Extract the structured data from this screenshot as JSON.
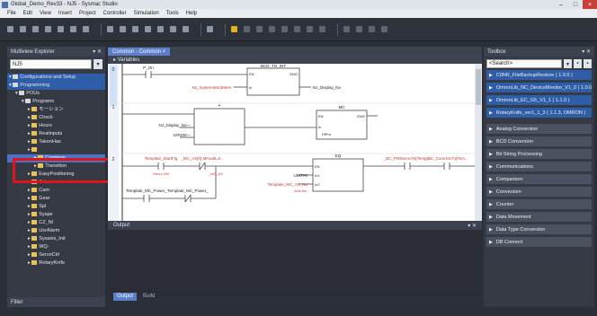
{
  "window": {
    "title": "Global_Demo_Rev33 - NJ5 - Sysmac Studio"
  },
  "menu": {
    "items": [
      "File",
      "Edit",
      "View",
      "Insert",
      "Project",
      "Controller",
      "Simulation",
      "Tools",
      "Help"
    ]
  },
  "multiview": {
    "title": "Multiview Explorer",
    "device": "NJ5",
    "tree": [
      {
        "label": "Configurations and Setup",
        "level": 1,
        "icon": "fd",
        "style": "blue"
      },
      {
        "label": "Programming",
        "level": 1,
        "icon": "fd",
        "style": "blue"
      },
      {
        "label": "POUs",
        "level": 2,
        "icon": "fd"
      },
      {
        "label": "Programs",
        "level": 3,
        "icon": "fd"
      },
      {
        "label": "モーション",
        "level": 4,
        "icon": "pg"
      },
      {
        "label": "Check",
        "level": 4,
        "icon": "pg"
      },
      {
        "label": "Hours",
        "level": 4,
        "icon": "pg"
      },
      {
        "label": "Realinputs",
        "level": 4,
        "icon": "pg"
      },
      {
        "label": "TakenHas",
        "level": 4,
        "icon": "pg"
      },
      {
        "label": "",
        "level": 4,
        "icon": "pg"
      },
      {
        "label": "Common",
        "level": 5,
        "icon": "pg",
        "style": "sel"
      },
      {
        "label": "Transition",
        "level": 5,
        "icon": "pg"
      },
      {
        "label": "EasyPositioning",
        "level": 4,
        "icon": "pg"
      },
      {
        "label": "Jet",
        "level": 4,
        "icon": "pg"
      },
      {
        "label": "Cam",
        "level": 4,
        "icon": "pg"
      },
      {
        "label": "Gear",
        "level": 4,
        "icon": "pg"
      },
      {
        "label": "Spl",
        "level": 4,
        "icon": "pg"
      },
      {
        "label": "Syspe",
        "level": 4,
        "icon": "pg"
      },
      {
        "label": "CZ_NI",
        "level": 4,
        "icon": "pg"
      },
      {
        "label": "UsrAlarm",
        "level": 4,
        "icon": "pg"
      },
      {
        "label": "Sysaxis_Init",
        "level": 4,
        "icon": "pg"
      },
      {
        "label": "WQ-",
        "level": 4,
        "icon": "pg"
      },
      {
        "label": "ServoCtrl",
        "level": 4,
        "icon": "pg"
      },
      {
        "label": "RotaryKnife",
        "level": 4,
        "icon": "pg"
      }
    ],
    "footer": "Filter"
  },
  "editor": {
    "tab": "Common - Common",
    "variables_label": "Variables",
    "rung_numbers": [
      "0",
      "1",
      "2"
    ],
    "rung0": {
      "contact1": "P_On",
      "fb_name": "BCD_TO_INT",
      "fb_en": "EN",
      "fb_eno": "ENO",
      "fb_in": "In",
      "input_var": "NJ_SystemWordMem -",
      "output_var": "NJ_Display_No"
    },
    "rung1": {
      "add_label": "+",
      "in1": "NJ_Display_No—",
      "in2": "10#200—",
      "mc_name": "MC",
      "mc_en": "EN",
      "mc_eno": "ENO",
      "mc_in": "In",
      "mc_out": "HiPro"
    },
    "rung2": {
      "contact1": "Template_StartFlg",
      "contact1_sub": "Servo ON",
      "contact2": "_MC_AX[0].MFaultLvl...",
      "contact2_sub": "_MC_AX",
      "contact3": "Template_MC_Power_",
      "contact4": "Template_MC_Power_",
      "eq_name": "EQ",
      "eq_en": "EN",
      "eq_in1": "In1",
      "eq_in2": "In2",
      "eq_const": "UINT#0",
      "eq_var": "Template_MC_AX_No",
      "eq_var_sub": "Axis No.",
      "right1": "_BC_P00ServoTo[Templ...",
      "right2": "_BC_ComrSrcTo[Tem..."
    }
  },
  "output": {
    "title": "Output"
  },
  "bottom_tabs": [
    "Output",
    "Build"
  ],
  "toolbox": {
    "title": "Toolbox",
    "search": "<Search>",
    "items": [
      {
        "label": "C0NR_FileBackupRestore ( 1.0.0 )",
        "type": "lib"
      },
      {
        "label": "OmronLib_NC_DeviceMonitor_V1_0 ( 1.0.0 )",
        "type": "lib"
      },
      {
        "label": "OmronLib_EC_G5_V1_1 ( 1.1.0 )",
        "type": "lib"
      },
      {
        "label": "RotaryKnife_ver1_1_3 ( 1.1.3, OMRON )",
        "type": "lib"
      },
      {
        "label": "Analog Conversion",
        "type": "cat"
      },
      {
        "label": "BCD Conversion",
        "type": "cat"
      },
      {
        "label": "Bit String Processing",
        "type": "cat"
      },
      {
        "label": "Communications",
        "type": "cat"
      },
      {
        "label": "Comparison",
        "type": "cat"
      },
      {
        "label": "Conversion",
        "type": "cat"
      },
      {
        "label": "Counter",
        "type": "cat"
      },
      {
        "label": "Data Movement",
        "type": "cat"
      },
      {
        "label": "Data Type Conversion",
        "type": "cat"
      },
      {
        "label": "DB Connect",
        "type": "cat"
      }
    ]
  },
  "colors": {
    "accent": "#5b7fc8",
    "highlight_box": "#e0151b",
    "variable_red": "#c0392b"
  }
}
